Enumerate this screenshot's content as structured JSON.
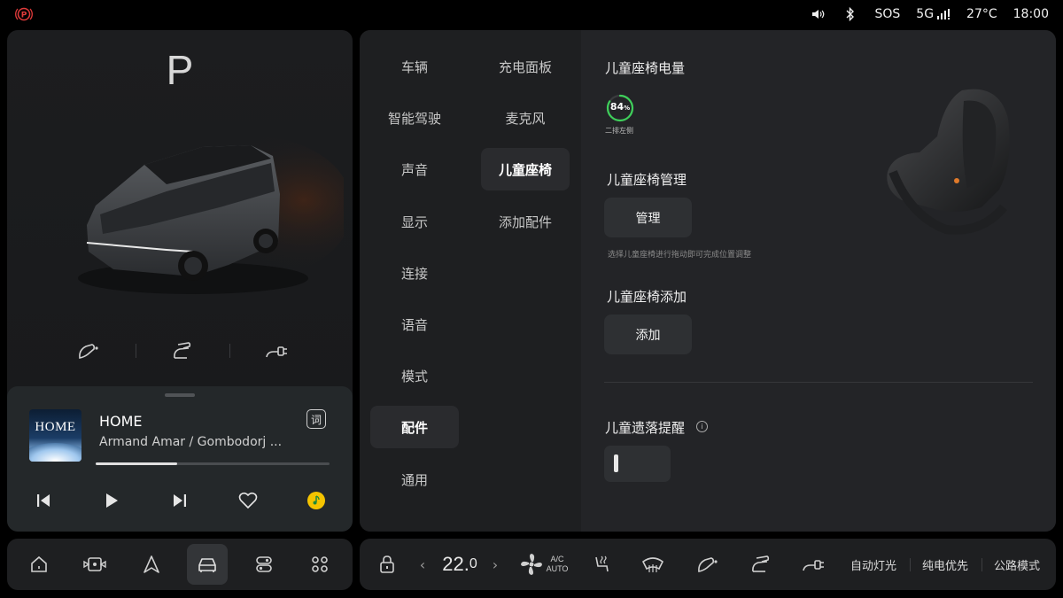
{
  "status": {
    "sos": "SOS",
    "network": "5G",
    "temperature": "27°C",
    "time": "18:00"
  },
  "vehicle": {
    "gear": "P"
  },
  "media": {
    "album_text": "HOME",
    "title": "HOME",
    "artist": "Armand Amar / Gombodorj ...",
    "lyrics_label": "词",
    "progress_fraction": 0.35
  },
  "settings_nav": {
    "col1": [
      "车辆",
      "智能驾驶",
      "声音",
      "显示",
      "连接",
      "语音",
      "模式",
      "配件",
      "通用"
    ],
    "col2": [
      "充电面板",
      "麦克风",
      "儿童座椅",
      "添加配件"
    ],
    "active_col1": "配件",
    "active_col2": "儿童座椅"
  },
  "child_seat": {
    "battery_title": "儿童座椅电量",
    "battery_percent": 84,
    "battery_value": "84",
    "battery_unit": "%",
    "battery_position": "二排左侧",
    "manage_title": "儿童座椅管理",
    "manage_button": "管理",
    "manage_hint": "选择儿童座椅进行拖动即可完成位置调整",
    "add_title": "儿童座椅添加",
    "add_button": "添加",
    "left_behind_title": "儿童遗落提醒",
    "info_symbol": "i",
    "left_behind_enabled": false
  },
  "climate": {
    "temperature_int": "22.",
    "temperature_dec": "0",
    "ac_label": "A/C",
    "ac_auto_label": "AUTO",
    "prev_symbol": "‹",
    "next_symbol": "›"
  },
  "quick_modes": [
    "自动灯光",
    "纯电优先",
    "公路模式"
  ],
  "colors": {
    "battery_ring": "#3ecf5a",
    "park_brake": "#e23b3b",
    "music_app": "#f5c400"
  }
}
